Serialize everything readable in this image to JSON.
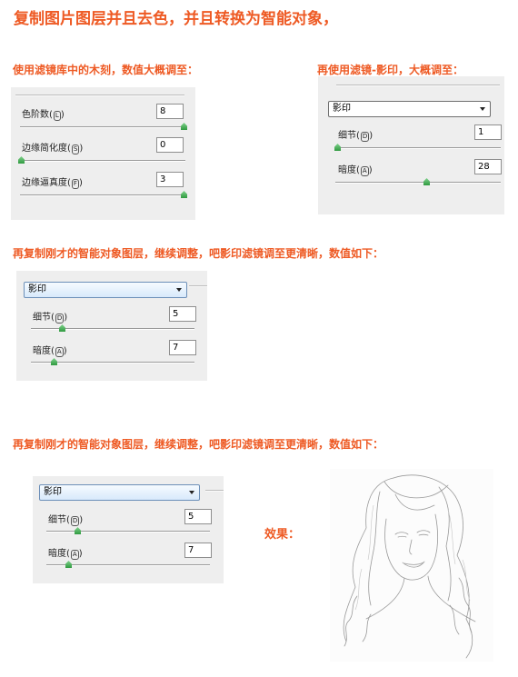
{
  "heading": "复制图片图层并且去色，并且转换为智能对象，",
  "section1": {
    "caption": "使用滤镜库中的木刻，数值大概调至：",
    "rows": [
      {
        "label": "色阶数",
        "hotkey": "L",
        "value": "8",
        "slider_fraction": 1.0
      },
      {
        "label": "边缘简化度",
        "hotkey": "S",
        "value": "0",
        "slider_fraction": 0.0
      },
      {
        "label": "边缘逼真度",
        "hotkey": "F",
        "value": "3",
        "slider_fraction": 1.0
      }
    ]
  },
  "section2": {
    "caption": "再使用滤镜-影印，大概调至：",
    "dropdown": "影印",
    "rows": [
      {
        "label": "细节",
        "hotkey": "D",
        "value": "1",
        "slider_fraction": 0.0
      },
      {
        "label": "暗度",
        "hotkey": "A",
        "value": "28",
        "slider_fraction": 0.56
      }
    ]
  },
  "section3": {
    "caption": "再复制刚才的智能对象图层，继续调整，吧影印滤镜调至更清晰，数值如下：",
    "dropdown": "影印",
    "rows": [
      {
        "label": "细节",
        "hotkey": "D",
        "value": "5",
        "slider_fraction": 0.19
      },
      {
        "label": "暗度",
        "hotkey": "A",
        "value": "7",
        "slider_fraction": 0.14
      }
    ]
  },
  "section4": {
    "caption": "再复制刚才的智能对象图层，继续调整，吧影印滤镜调至更清晰，数值如下：",
    "dropdown": "影印",
    "rows": [
      {
        "label": "细节",
        "hotkey": "D",
        "value": "5",
        "slider_fraction": 0.19
      },
      {
        "label": "暗度",
        "hotkey": "A",
        "value": "7",
        "slider_fraction": 0.14
      }
    ]
  },
  "result_label": "效果："
}
